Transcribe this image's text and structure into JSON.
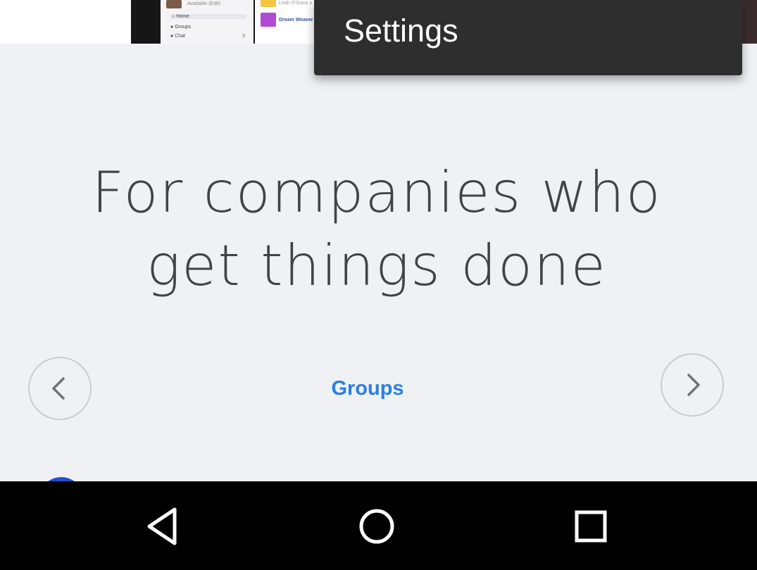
{
  "hero": {
    "status_text": "Available (Edit)",
    "menu": {
      "home": "Home",
      "groups": "Groups",
      "chat": "Chat",
      "chat_count": "3"
    },
    "content": {
      "row1_sub": "Leah O'Gana p",
      "row2_name": "Dream Weaver"
    }
  },
  "menu_popup": {
    "settings_label": "Settings"
  },
  "main": {
    "headline": "For companies who get things done",
    "carousel_label": "Groups"
  },
  "icons": {
    "prev": "chevron-left-icon",
    "next": "chevron-right-icon",
    "back": "back-triangle-icon",
    "home": "home-circle-icon",
    "recents": "recents-square-icon"
  },
  "colors": {
    "background": "#eff1f4",
    "headline": "#404448",
    "accent_link": "#2b7fe0",
    "popup_bg": "#2e2e2e",
    "nav_bar": "#000000"
  }
}
